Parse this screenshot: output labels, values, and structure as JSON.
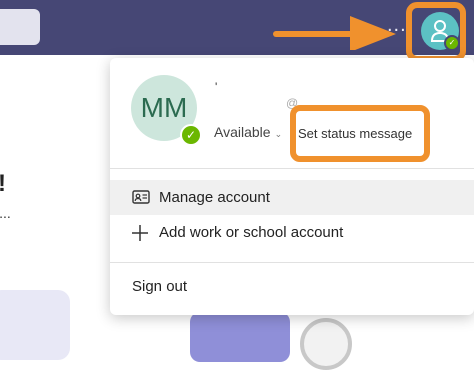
{
  "header": {
    "more_label": "...",
    "avatar_icon": "person-icon",
    "status_icon": "check-icon"
  },
  "background": {
    "exclaim": "!",
    "ellipsis": "l..."
  },
  "profile": {
    "initials": "MM",
    "name": "'",
    "email_fragment": "@",
    "status": "Available",
    "status_chevron": "⌄",
    "set_status": "Set status message"
  },
  "menu": {
    "manage_account": "Manage account",
    "add_account": "Add work or school account",
    "sign_out": "Sign out"
  },
  "colors": {
    "header": "#464775",
    "highlight": "#f0912d",
    "available": "#6bb700",
    "avatar_bg": "#cde6dc"
  }
}
